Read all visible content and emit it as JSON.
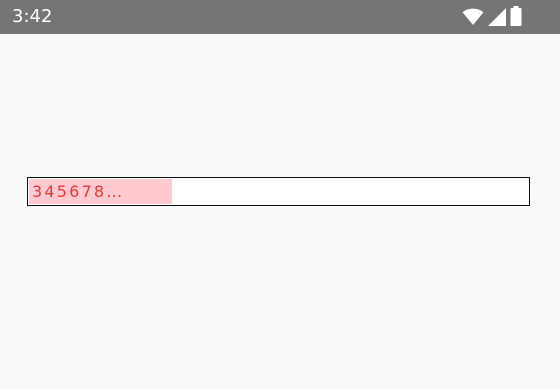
{
  "status_bar": {
    "time": "3:42",
    "icons": [
      "wifi-icon",
      "cellular-signal-icon",
      "battery-icon"
    ],
    "background_color": "#757575"
  },
  "text_field": {
    "value": "345678…",
    "text_color": "#e53935",
    "highlight_color": "#ffc9d0",
    "border_color": "#111111"
  },
  "background_color": "#fafafa"
}
